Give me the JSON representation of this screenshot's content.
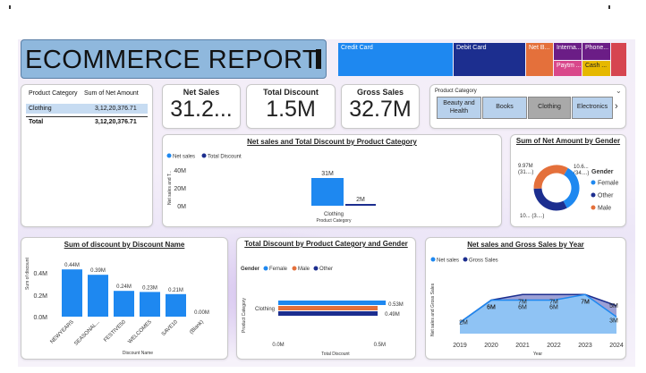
{
  "header": {
    "title": "ECOMMERCE REPORT"
  },
  "colors": {
    "primary_blue": "#1e88f0",
    "navy": "#1c2e8f",
    "orange": "#e4703b",
    "purple": "#6b1d86",
    "pink": "#d9488b",
    "gold": "#e6b800",
    "red": "#d64550",
    "title_bg": "#8fb8dd"
  },
  "treemap": {
    "items": [
      {
        "label": "Credit Card",
        "color": "#1e88f0"
      },
      {
        "label": "Debit Card",
        "color": "#1c2e8f"
      },
      {
        "label": "Net B...",
        "color": "#e4703b"
      },
      {
        "label": "Interna...",
        "color": "#6b1d86"
      },
      {
        "label": "Paytm ...",
        "color": "#d9488b"
      },
      {
        "label": "Phone...",
        "color": "#6b1d86"
      },
      {
        "label": "Cash ...",
        "color": "#e6b800"
      },
      {
        "label": "",
        "color": "#d64550"
      }
    ]
  },
  "summary_table": {
    "headers": [
      "Product Category",
      "Sum of Net Amount"
    ],
    "rows": [
      {
        "category": "Clothing",
        "value": "3,12,20,376.71"
      }
    ],
    "total": {
      "label": "Total",
      "value": "3,12,20,376.71"
    }
  },
  "kpis": [
    {
      "label": "Net Sales",
      "value": "31.2..."
    },
    {
      "label": "Total Discount",
      "value": "1.5M"
    },
    {
      "label": "Gross Sales",
      "value": "32.7M"
    }
  ],
  "slicer": {
    "title": "Product Category",
    "options": [
      "Beauty and Health",
      "Books",
      "Clothing",
      "Electronics"
    ],
    "selected": "Clothing"
  },
  "charts": {
    "net_vs_discount": {
      "title": "Net sales and Total Discount by Product Category",
      "legend": [
        "Net sales",
        "Total Discount"
      ],
      "ylabel": "Net sales and T...",
      "xlabel": "Product Category",
      "yticks": [
        "40M",
        "20M",
        "0M"
      ],
      "category": "Clothing",
      "labels": [
        "31M",
        "2M"
      ]
    },
    "gender_donut": {
      "title": "Sum of Net Amount by Gender",
      "legend_title": "Gender",
      "legend": [
        "Female",
        "Other",
        "Male"
      ],
      "labels": [
        "9.97M",
        "(31....)",
        "10.6...",
        "(34....)",
        "10... (3....)"
      ]
    },
    "discount_name": {
      "title": "Sum of discount by Discount Name",
      "ylabel": "Sum of discount",
      "xlabel": "Discount Name",
      "yticks": [
        "0.4M",
        "0.2M",
        "0.0M"
      ]
    },
    "discount_gender": {
      "title": "Total Discount by Product Category and Gender",
      "legend_title": "Gender",
      "legend": [
        "Female",
        "Male",
        "Other"
      ],
      "ylabel": "Product Category",
      "xlabel": "Total Discount",
      "xticks": [
        "0.0M",
        "0.5M"
      ]
    },
    "net_gross_year": {
      "title": "Net sales and Gross Sales by Year",
      "legend": [
        "Net sales",
        "Gross Sales"
      ],
      "ylabel": "Net sales and Gross Sales",
      "xlabel": "Year"
    }
  },
  "chart_data": [
    {
      "type": "bar",
      "title": "Net sales and Total Discount by Product Category",
      "categories": [
        "Clothing"
      ],
      "series": [
        {
          "name": "Net sales",
          "values": [
            31
          ]
        },
        {
          "name": "Total Discount",
          "values": [
            2
          ]
        }
      ],
      "data_labels": [
        "31M",
        "2M"
      ],
      "xlabel": "Product Category",
      "ylabel": "Net sales and T...",
      "ylim": [
        0,
        40
      ],
      "unit": "M"
    },
    {
      "type": "pie",
      "title": "Sum of Net Amount by Gender",
      "categories": [
        "Female",
        "Other",
        "Male"
      ],
      "values": [
        10.6,
        9.97,
        10.6
      ],
      "data_labels": [
        "10.6... (34....)",
        "9.97M (31....)",
        "10... (3....)"
      ]
    },
    {
      "type": "bar",
      "title": "Sum of discount by Discount Name",
      "categories": [
        "NEWYEARS",
        "SEASONAL...",
        "FESTIVE50",
        "WELCOME5",
        "SAVE10",
        "(Blank)"
      ],
      "values": [
        0.44,
        0.39,
        0.24,
        0.23,
        0.21,
        0.0
      ],
      "data_labels": [
        "0.44M",
        "0.39M",
        "0.24M",
        "0.23M",
        "0.21M",
        "0.00M"
      ],
      "xlabel": "Discount Name",
      "ylabel": "Sum of discount",
      "ylim": [
        0,
        0.5
      ]
    },
    {
      "type": "bar",
      "title": "Total Discount by Product Category and Gender",
      "categories": [
        "Clothing"
      ],
      "series": [
        {
          "name": "Female",
          "values": [
            0.53
          ]
        },
        {
          "name": "Male",
          "values": [
            0.49
          ]
        },
        {
          "name": "Other",
          "values": [
            0.49
          ]
        }
      ],
      "data_labels": [
        "0.53M",
        "0.49M"
      ],
      "xlabel": "Total Discount",
      "ylabel": "Product Category",
      "xlim": [
        0,
        0.75
      ]
    },
    {
      "type": "area",
      "title": "Net sales and Gross Sales by Year",
      "x": [
        2019,
        2020,
        2021,
        2022,
        2023,
        2024
      ],
      "series": [
        {
          "name": "Net sales",
          "values": [
            2,
            6,
            6,
            6,
            7,
            3
          ]
        },
        {
          "name": "Gross Sales",
          "values": [
            2,
            6,
            7,
            7,
            7,
            5
          ]
        }
      ],
      "data_labels": {
        "Net sales": [
          "",
          "6M",
          "6M",
          "6M",
          "7M",
          "3M"
        ],
        "Gross Sales": [
          "2M",
          "6M",
          "7M",
          "7M",
          "7M",
          "5M"
        ]
      },
      "xlabel": "Year",
      "ylabel": "Net sales and Gross Sales",
      "ylim": [
        0,
        8
      ]
    }
  ]
}
